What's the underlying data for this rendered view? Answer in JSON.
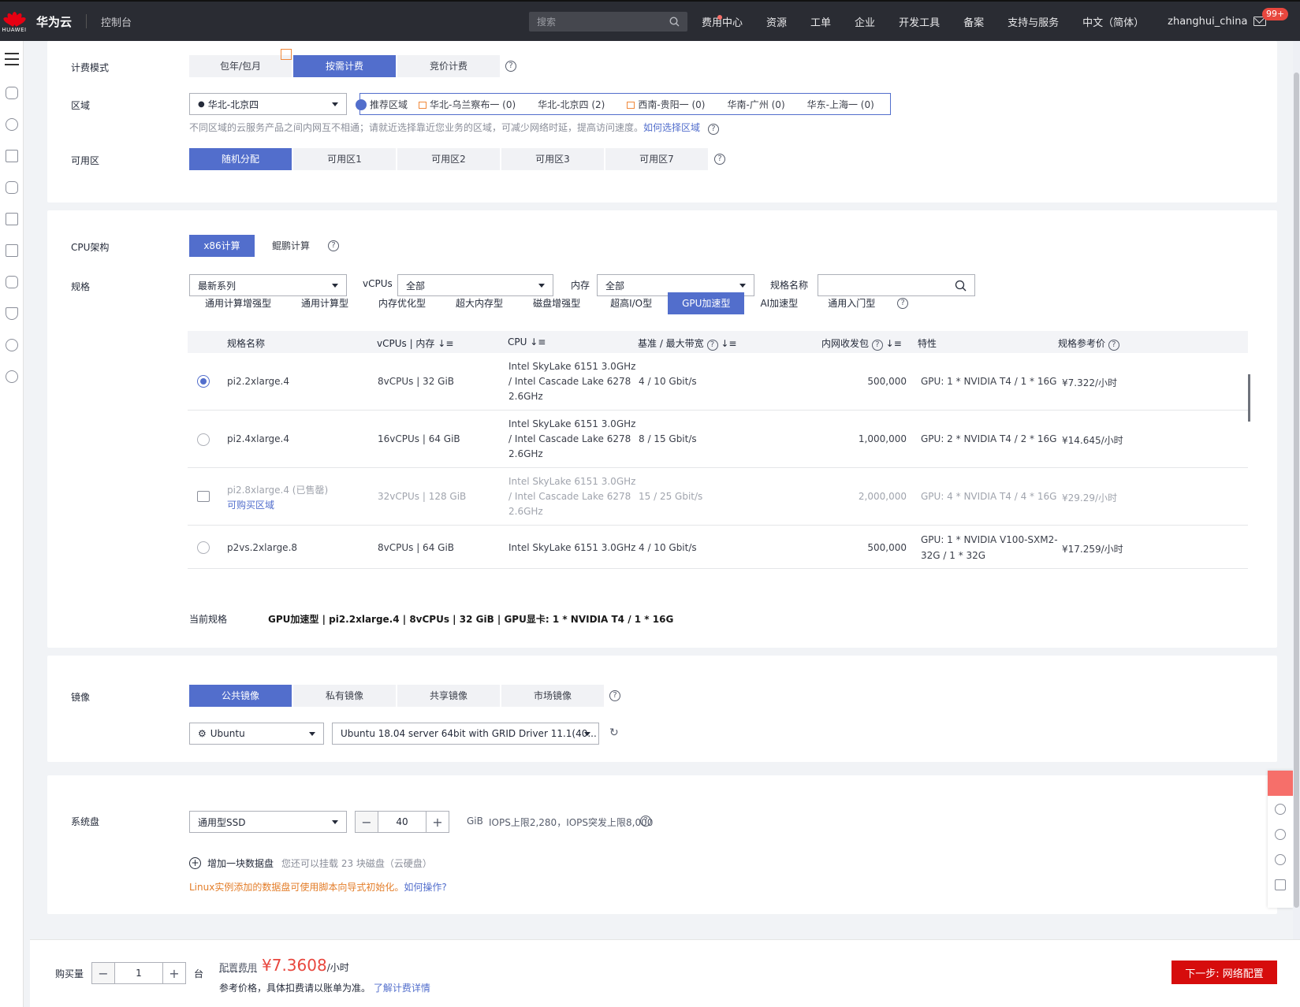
{
  "header": {
    "logo_text": "HUAWEI",
    "brand": "华为云",
    "console": "控制台",
    "search_placeholder": "搜索",
    "nav": [
      "费用中心",
      "资源",
      "工单",
      "企业",
      "开发工具",
      "备案",
      "支持与服务",
      "中文（简体）",
      "zhanghui_china"
    ],
    "mail_badge": "99+"
  },
  "billing": {
    "label": "计费模式",
    "options": [
      "包年/包月",
      "按需计费",
      "竞价计费"
    ],
    "selected": "按需计费"
  },
  "region": {
    "label": "区域",
    "value": "华北-北京四",
    "recommend_label": "推荐区域",
    "recommended": [
      "华北-乌兰察布一 (0)",
      "华北-北京四 (2)",
      "西南-贵阳一 (0)",
      "华南-广州 (0)",
      "华东-上海一 (0)"
    ],
    "hint": "不同区域的云服务产品之间内网互不相通；请就近选择靠近您业务的区域，可减少网络时延，提高访问速度。",
    "hint_link": "如何选择区域"
  },
  "az": {
    "label": "可用区",
    "options": [
      "随机分配",
      "可用区1",
      "可用区2",
      "可用区3",
      "可用区7"
    ],
    "selected": "随机分配"
  },
  "cpu_arch": {
    "label": "CPU架构",
    "options": [
      "x86计算",
      "鲲鹏计算"
    ],
    "selected": "x86计算"
  },
  "spec": {
    "label": "规格",
    "series_value": "最新系列",
    "vcpus_label": "vCPUs",
    "vcpus_value": "全部",
    "mem_label": "内存",
    "mem_value": "全部",
    "name_label": "规格名称",
    "types": [
      "通用计算增强型",
      "通用计算型",
      "内存优化型",
      "超大内存型",
      "磁盘增强型",
      "超高I/O型",
      "GPU加速型",
      "AI加速型",
      "通用入门型"
    ],
    "selected_type": "GPU加速型",
    "columns": [
      "规格名称",
      "vCPUs | 内存",
      "CPU",
      "基准 / 最大带宽",
      "内网收发包",
      "特性",
      "规格参考价"
    ],
    "rows": [
      {
        "name": "pi2.2xlarge.4",
        "vcpus_mem": "8vCPUs | 32 GiB",
        "cpu1": "Intel SkyLake 6151 3.0GHz",
        "cpu2": "/ Intel Cascade Lake 6278",
        "cpu3": "2.6GHz",
        "bandwidth": "4 / 10 Gbit/s",
        "pps": "500,000",
        "feature1": "GPU: 1 * NVIDIA T4 / 1 * 16G",
        "feature2": "",
        "price": "¥7.322/小时",
        "state": "selected"
      },
      {
        "name": "pi2.4xlarge.4",
        "vcpus_mem": "16vCPUs | 64 GiB",
        "cpu1": "Intel SkyLake 6151 3.0GHz",
        "cpu2": "/ Intel Cascade Lake 6278",
        "cpu3": "2.6GHz",
        "bandwidth": "8 / 15 Gbit/s",
        "pps": "1,000,000",
        "feature1": "GPU: 2 * NVIDIA T4 / 2 * 16G",
        "feature2": "",
        "price": "¥14.645/小时",
        "state": "available"
      },
      {
        "name": "pi2.8xlarge.4 (已售罄)",
        "sub_link": "可购买区域",
        "vcpus_mem": "32vCPUs | 128 GiB",
        "cpu1": "Intel SkyLake 6151 3.0GHz",
        "cpu2": "/ Intel Cascade Lake 6278",
        "cpu3": "2.6GHz",
        "bandwidth": "15 / 25 Gbit/s",
        "pps": "2,000,000",
        "feature1": "GPU: 4 * NVIDIA T4 / 4 * 16G",
        "feature2": "",
        "price": "¥29.29/小时",
        "state": "soldout"
      },
      {
        "name": "p2vs.2xlarge.8",
        "vcpus_mem": "8vCPUs | 64 GiB",
        "cpu1": "Intel SkyLake 6151 3.0GHz",
        "cpu2": "",
        "cpu3": "",
        "bandwidth": "4 / 10 Gbit/s",
        "pps": "500,000",
        "feature1": "GPU: 1 * NVIDIA V100-SXM2-",
        "feature2": "32G / 1 * 32G",
        "price": "¥17.259/小时",
        "state": "available"
      }
    ],
    "current_label": "当前规格",
    "current_value": "GPU加速型 | pi2.2xlarge.4 | 8vCPUs | 32 GiB | GPU显卡: 1 * NVIDIA T4 / 1 * 16G"
  },
  "image": {
    "label": "镜像",
    "options": [
      "公共镜像",
      "私有镜像",
      "共享镜像",
      "市场镜像"
    ],
    "selected": "公共镜像",
    "os": "Ubuntu",
    "version": "Ubuntu 18.04 server 64bit with GRID Driver 11.1(40..."
  },
  "disk": {
    "label": "系统盘",
    "type": "通用型SSD",
    "size": "40",
    "unit": "GiB",
    "iops": "IOPS上限2,280，IOPS突发上限8,000",
    "add_label": "增加一块数据盘",
    "add_hint": "您还可以挂载 23 块磁盘（云硬盘）",
    "linux_hint": "Linux实例添加的数据盘可使用脚本向导式初始化。",
    "linux_link": "如何操作?"
  },
  "footer": {
    "qty_label": "购买量",
    "qty": "1",
    "qty_unit": "台",
    "fee_label": "配置费用",
    "fee": "¥7.3608",
    "fee_unit": "/小时",
    "fee_note": "参考价格，具体扣费请以账单为准。",
    "fee_link": "了解计费详情",
    "next": "下一步: 网络配置"
  },
  "colors": {
    "primary": "#526ecc",
    "topbar": "#2a2c33",
    "price": "#e8473e",
    "next_button": "#d60c0c",
    "warning_text": "#e37d29"
  }
}
